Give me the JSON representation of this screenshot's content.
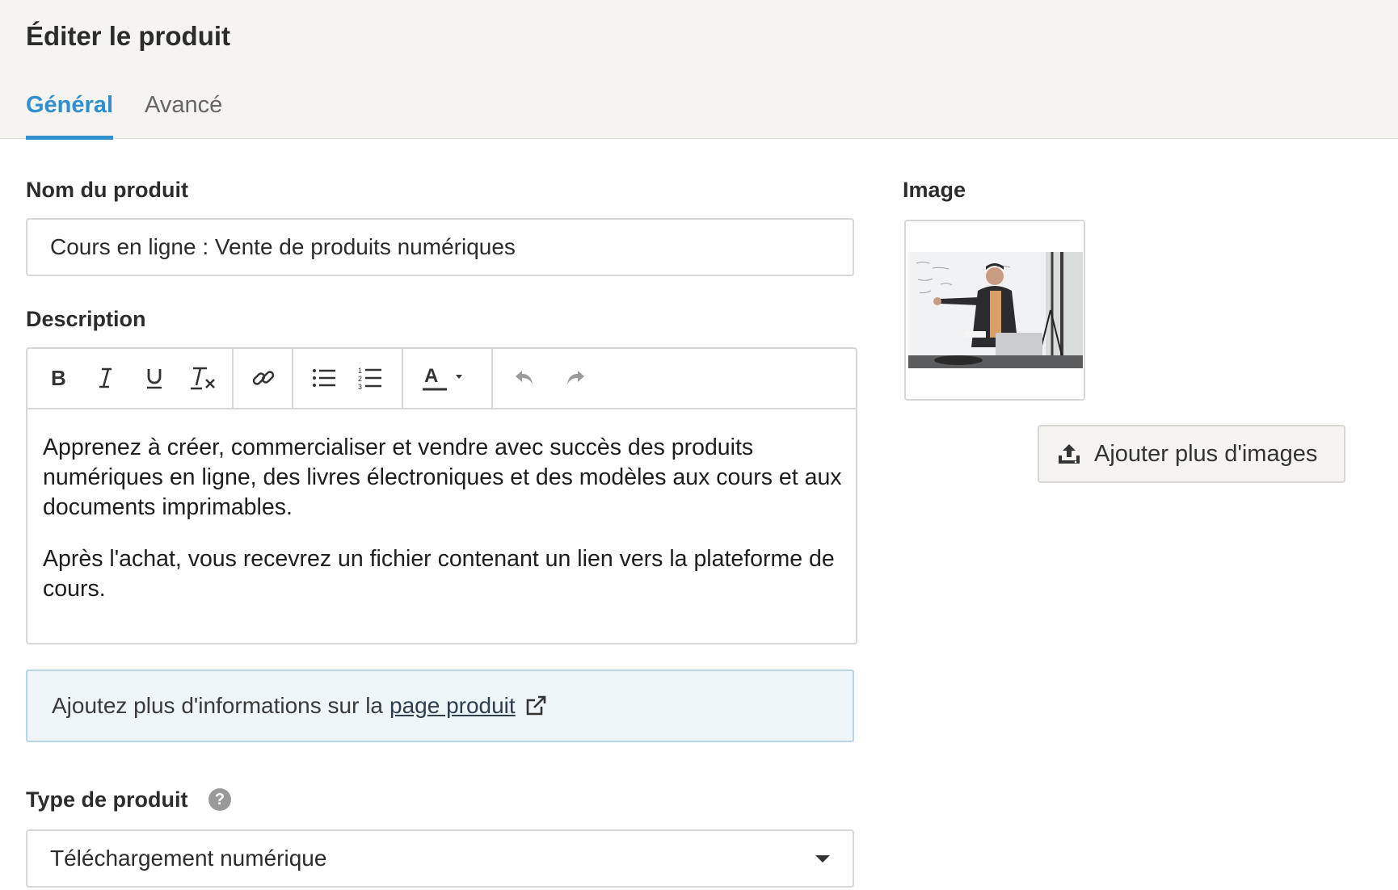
{
  "header": {
    "title": "Éditer le produit",
    "tabs": [
      {
        "label": "Général",
        "active": true
      },
      {
        "label": "Avancé",
        "active": false
      }
    ]
  },
  "form": {
    "name_label": "Nom du produit",
    "name_value": "Cours en ligne : Vente de produits numériques",
    "description_label": "Description",
    "description_paragraphs": [
      "Apprenez à créer, commercialiser et vendre avec succès des produits numériques en ligne, des livres électroniques et des modèles aux cours et aux documents imprimables.",
      "Après l'achat, vous recevrez un fichier contenant un lien vers la plateforme de cours."
    ],
    "toolbar_icons": [
      "bold-icon",
      "italic-icon",
      "underline-icon",
      "clear-format-icon",
      "link-icon",
      "bullet-list-icon",
      "numbered-list-icon",
      "text-color-icon",
      "undo-icon",
      "redo-icon"
    ],
    "info_text": "Ajoutez plus d'informations sur la",
    "info_link": "page produit",
    "type_label": "Type de produit",
    "type_value": "Téléchargement numérique"
  },
  "image": {
    "label": "Image",
    "upload_button": "Ajouter plus d'images"
  },
  "colors": {
    "accent": "#2f8fcf",
    "header_bg": "#f5f4f0",
    "info_bg": "#eef6f9"
  }
}
